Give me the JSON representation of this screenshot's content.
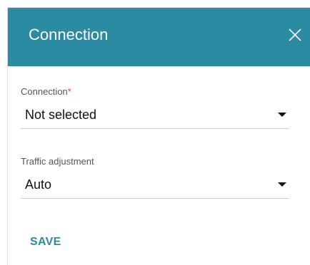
{
  "dialog": {
    "title": "Connection",
    "close_icon": "close-icon"
  },
  "fields": [
    {
      "label": "Connection",
      "required_mark": "*",
      "value": "Not selected"
    },
    {
      "label": "Traffic adjustment",
      "value": "Auto"
    }
  ],
  "actions": {
    "save_label": "SAVE"
  },
  "colors": {
    "header": "#2b8ba3",
    "accent": "#2b8ba3",
    "required": "#e53935"
  }
}
